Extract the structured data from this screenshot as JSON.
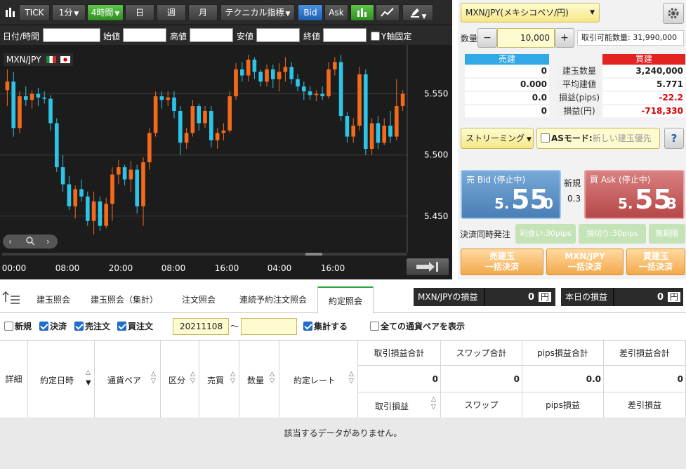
{
  "toolbar": {
    "tick": "TICK",
    "interval": "1分",
    "timeframe": "4時間",
    "day": "日",
    "week": "週",
    "month": "月",
    "technical": "テクニカル指標",
    "bid": "Bid",
    "ask": "Ask"
  },
  "ohlc_bar": {
    "datetime_label": "日付/時間",
    "open_label": "始値",
    "high_label": "高値",
    "low_label": "安値",
    "close_label": "終値",
    "yfix_label": "Y軸固定"
  },
  "chart_data": {
    "type": "candlestick",
    "title": "MXN/JPY",
    "ylim": [
      5.42,
      5.59
    ],
    "yticks": [
      "5.550",
      "5.500",
      "5.450"
    ],
    "xticks": [
      "00:00",
      "08:00",
      "20:00",
      "08:00",
      "16:00",
      "04:00",
      "16:00"
    ],
    "candles": [
      {
        "o": 5.553,
        "h": 5.57,
        "l": 5.54,
        "c": 5.56
      },
      {
        "o": 5.56,
        "h": 5.568,
        "l": 5.515,
        "c": 5.522
      },
      {
        "o": 5.522,
        "h": 5.552,
        "l": 5.518,
        "c": 5.548
      },
      {
        "o": 5.548,
        "h": 5.556,
        "l": 5.54,
        "c": 5.545
      },
      {
        "o": 5.545,
        "h": 5.553,
        "l": 5.538,
        "c": 5.55
      },
      {
        "o": 5.55,
        "h": 5.555,
        "l": 5.54,
        "c": 5.547
      },
      {
        "o": 5.547,
        "h": 5.552,
        "l": 5.542,
        "c": 5.546
      },
      {
        "o": 5.546,
        "h": 5.549,
        "l": 5.52,
        "c": 5.526
      },
      {
        "o": 5.526,
        "h": 5.53,
        "l": 5.486,
        "c": 5.49
      },
      {
        "o": 5.49,
        "h": 5.5,
        "l": 5.47,
        "c": 5.476
      },
      {
        "o": 5.476,
        "h": 5.483,
        "l": 5.455,
        "c": 5.458
      },
      {
        "o": 5.458,
        "h": 5.475,
        "l": 5.448,
        "c": 5.472
      },
      {
        "o": 5.472,
        "h": 5.48,
        "l": 5.462,
        "c": 5.466
      },
      {
        "o": 5.466,
        "h": 5.47,
        "l": 5.442,
        "c": 5.446
      },
      {
        "o": 5.446,
        "h": 5.47,
        "l": 5.435,
        "c": 5.462
      },
      {
        "o": 5.462,
        "h": 5.466,
        "l": 5.438,
        "c": 5.442
      },
      {
        "o": 5.442,
        "h": 5.465,
        "l": 5.44,
        "c": 5.46
      },
      {
        "o": 5.46,
        "h": 5.49,
        "l": 5.446,
        "c": 5.484
      },
      {
        "o": 5.484,
        "h": 5.496,
        "l": 5.476,
        "c": 5.49
      },
      {
        "o": 5.49,
        "h": 5.492,
        "l": 5.475,
        "c": 5.48
      },
      {
        "o": 5.48,
        "h": 5.495,
        "l": 5.47,
        "c": 5.488
      },
      {
        "o": 5.488,
        "h": 5.492,
        "l": 5.452,
        "c": 5.458
      },
      {
        "o": 5.458,
        "h": 5.498,
        "l": 5.442,
        "c": 5.494
      },
      {
        "o": 5.494,
        "h": 5.522,
        "l": 5.488,
        "c": 5.518
      },
      {
        "o": 5.518,
        "h": 5.552,
        "l": 5.515,
        "c": 5.548
      },
      {
        "o": 5.548,
        "h": 5.552,
        "l": 5.538,
        "c": 5.545
      },
      {
        "o": 5.545,
        "h": 5.552,
        "l": 5.54,
        "c": 5.547
      },
      {
        "o": 5.547,
        "h": 5.552,
        "l": 5.53,
        "c": 5.536
      },
      {
        "o": 5.536,
        "h": 5.54,
        "l": 5.5,
        "c": 5.51
      },
      {
        "o": 5.51,
        "h": 5.522,
        "l": 5.505,
        "c": 5.518
      },
      {
        "o": 5.518,
        "h": 5.545,
        "l": 5.515,
        "c": 5.54
      },
      {
        "o": 5.54,
        "h": 5.542,
        "l": 5.52,
        "c": 5.526
      },
      {
        "o": 5.526,
        "h": 5.54,
        "l": 5.522,
        "c": 5.536
      },
      {
        "o": 5.536,
        "h": 5.54,
        "l": 5.506,
        "c": 5.512
      },
      {
        "o": 5.512,
        "h": 5.522,
        "l": 5.505,
        "c": 5.518
      },
      {
        "o": 5.518,
        "h": 5.526,
        "l": 5.512,
        "c": 5.52
      },
      {
        "o": 5.52,
        "h": 5.552,
        "l": 5.518,
        "c": 5.548
      },
      {
        "o": 5.548,
        "h": 5.575,
        "l": 5.545,
        "c": 5.57
      },
      {
        "o": 5.57,
        "h": 5.576,
        "l": 5.56,
        "c": 5.565
      },
      {
        "o": 5.565,
        "h": 5.582,
        "l": 5.56,
        "c": 5.578
      },
      {
        "o": 5.578,
        "h": 5.58,
        "l": 5.562,
        "c": 5.568
      },
      {
        "o": 5.568,
        "h": 5.57,
        "l": 5.556,
        "c": 5.56
      },
      {
        "o": 5.56,
        "h": 5.574,
        "l": 5.556,
        "c": 5.57
      },
      {
        "o": 5.57,
        "h": 5.574,
        "l": 5.555,
        "c": 5.562
      },
      {
        "o": 5.562,
        "h": 5.575,
        "l": 5.552,
        "c": 5.568
      },
      {
        "o": 5.568,
        "h": 5.58,
        "l": 5.56,
        "c": 5.572
      },
      {
        "o": 5.572,
        "h": 5.576,
        "l": 5.558,
        "c": 5.562
      },
      {
        "o": 5.562,
        "h": 5.566,
        "l": 5.552,
        "c": 5.556
      },
      {
        "o": 5.556,
        "h": 5.56,
        "l": 5.545,
        "c": 5.552
      },
      {
        "o": 5.552,
        "h": 5.556,
        "l": 5.545,
        "c": 5.549
      },
      {
        "o": 5.549,
        "h": 5.553,
        "l": 5.544,
        "c": 5.55
      },
      {
        "o": 5.55,
        "h": 5.556,
        "l": 5.545,
        "c": 5.548
      },
      {
        "o": 5.548,
        "h": 5.576,
        "l": 5.546,
        "c": 5.57
      },
      {
        "o": 5.57,
        "h": 5.58,
        "l": 5.565,
        "c": 5.576
      },
      {
        "o": 5.576,
        "h": 5.582,
        "l": 5.528,
        "c": 5.532
      },
      {
        "o": 5.532,
        "h": 5.535,
        "l": 5.51,
        "c": 5.515
      },
      {
        "o": 5.515,
        "h": 5.53,
        "l": 5.51,
        "c": 5.524
      },
      {
        "o": 5.524,
        "h": 5.572,
        "l": 5.52,
        "c": 5.566
      },
      {
        "o": 5.566,
        "h": 5.57,
        "l": 5.5,
        "c": 5.505
      },
      {
        "o": 5.505,
        "h": 5.53,
        "l": 5.5,
        "c": 5.526
      },
      {
        "o": 5.526,
        "h": 5.532,
        "l": 5.505,
        "c": 5.51
      },
      {
        "o": 5.51,
        "h": 5.53,
        "l": 5.508,
        "c": 5.524
      },
      {
        "o": 5.524,
        "h": 5.536,
        "l": 5.51,
        "c": 5.515
      },
      {
        "o": 5.515,
        "h": 5.562,
        "l": 5.512,
        "c": 5.54
      },
      {
        "o": 5.54,
        "h": 5.553,
        "l": 5.536,
        "c": 5.55
      }
    ]
  },
  "chart_label": "MXN/JPY",
  "side": {
    "pair_select": "MXN/JPY(メキシコペソ/円)",
    "qty_label": "数量",
    "qty_value": "10,000",
    "tradable_label": "取引可能数量: 31,990,000",
    "sell_header": "売建",
    "buy_header": "買建",
    "rows": [
      {
        "left": "0",
        "label": "建玉数量",
        "right": "3,240,000"
      },
      {
        "left": "0.000",
        "label": "平均建値",
        "right": "5.771"
      },
      {
        "left": "0.0",
        "label": "損益(pips)",
        "right": "-22.2"
      },
      {
        "left": "0",
        "label": "損益(円)",
        "right": "-718,330"
      }
    ],
    "streaming": "ストリーミング",
    "as_mode": "ASモード:",
    "as_mode_hint": "新しい建玉優先",
    "help": "?",
    "bid_label": "売 Bid (停止中)",
    "bid_price_small": "5.",
    "bid_price_big": "55",
    "bid_price_last": "0",
    "ask_label": "買 Ask (停止中)",
    "ask_price_small": "5.",
    "ask_price_big": "55",
    "ask_price_last": "3",
    "new_label": "新規",
    "spread": "0.3",
    "settle_label": "決済同時発注",
    "take_profit": "利食い:30pips",
    "stop_loss": "損切り:30pips",
    "unlimited": "無期限",
    "sell_close_1": "売建玉",
    "sell_close_2": "一括決済",
    "pair_close_1": "MXN/JPY",
    "pair_close_2": "一括決済",
    "buy_close_1": "買建玉",
    "buy_close_2": "一括決済"
  },
  "tabs": [
    "建玉照会",
    "建玉照会（集計）",
    "注文照会",
    "連続予約注文照会",
    "約定照会"
  ],
  "pnl": {
    "pair_label": "MXN/JPYの損益",
    "pair_value": "0",
    "today_label": "本日の損益",
    "today_value": "0",
    "unit": "円"
  },
  "filters": {
    "new": "新規",
    "settle": "決済",
    "sell_order": "売注文",
    "buy_order": "買注文",
    "date_from": "20211108",
    "tilde": "〜",
    "aggregate": "集計する",
    "all_pairs": "全ての通貨ペアを表示"
  },
  "table": {
    "cols": [
      "詳細",
      "約定日時",
      "通貨ペア",
      "区分",
      "売買",
      "数量",
      "約定レート"
    ],
    "sum_headers": [
      "取引損益合計",
      "スワップ合計",
      "pips損益合計",
      "差引損益合計"
    ],
    "sum_values": [
      "0",
      "0",
      "0.0",
      "0"
    ],
    "sub_headers": [
      "取引損益",
      "スワップ",
      "pips損益",
      "差引損益"
    ],
    "empty": "該当するデータがありません。"
  }
}
